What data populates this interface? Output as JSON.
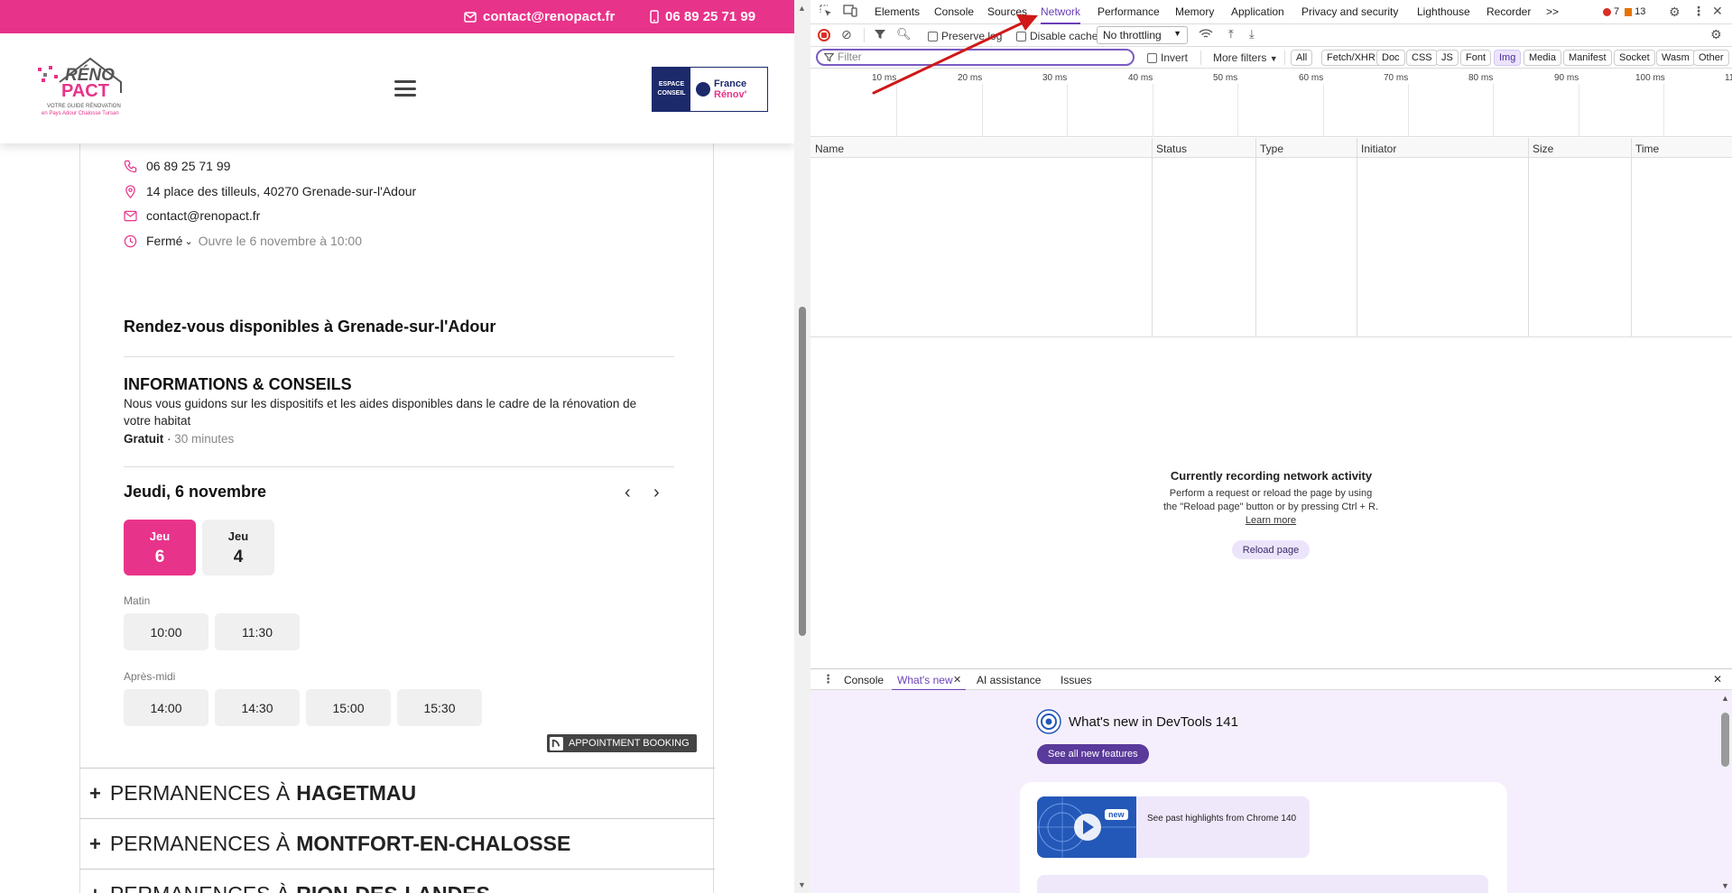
{
  "site": {
    "topbar": {
      "email": "contact@renopact.fr",
      "phone": "06 89 25 71 99"
    },
    "logo": {
      "brand_top": "RÉNO",
      "brand_bottom": "PACT",
      "tagline1": "VOTRE GUIDE RÉNOVATION",
      "tagline2": "en Pays Adour Chalosse Tursan"
    },
    "badge": {
      "left_line1": "ESPACE",
      "left_line2": "CONSEIL",
      "right_line1": "France",
      "right_line2": "Rénov'"
    },
    "contact": {
      "phone": "06 89 25 71 99",
      "address": "14 place des tilleuls, 40270 Grenade-sur-l'Adour",
      "email": "contact@renopact.fr",
      "status": "Fermé",
      "opens": "Ouvre le 6 novembre à 10:00"
    },
    "rdv_title": "Rendez-vous disponibles à Grenade-sur-l'Adour",
    "service": {
      "title": "INFORMATIONS & CONSEILS",
      "description": "Nous vous guidons sur les dispositifs et les aides disponibles dans le cadre de la rénovation de votre habitat",
      "price": "Gratuit",
      "separator": " · ",
      "duration": "30 minutes"
    },
    "date_heading": "Jeudi, 6 novembre",
    "days": [
      {
        "name": "Jeu",
        "num": "6"
      },
      {
        "name": "Jeu",
        "num": "4"
      }
    ],
    "morning_label": "Matin",
    "morning_slots": [
      "10:00",
      "11:30"
    ],
    "afternoon_label": "Après-midi",
    "afternoon_slots": [
      "14:00",
      "14:30",
      "15:00",
      "15:30"
    ],
    "booking_tag": "APPOINTMENT BOOKING",
    "permanences": [
      {
        "prefix": "PERMANENCES À",
        "city": "HAGETMAU"
      },
      {
        "prefix": "PERMANENCES À",
        "city": "MONTFORT-EN-CHALOSSE"
      },
      {
        "prefix": "PERMANENCES À",
        "city": "RION-DES-LANDES"
      }
    ]
  },
  "devtools": {
    "tabs": [
      "Elements",
      "Console",
      "Sources",
      "Network",
      "Performance",
      "Memory",
      "Application",
      "Privacy and security",
      "Lighthouse",
      "Recorder"
    ],
    "more_tabs": ">>",
    "errors": "7",
    "warnings": "13",
    "toolbar": {
      "preserve_log": "Preserve log",
      "disable_cache": "Disable cache",
      "throttling": "No throttling"
    },
    "filter_placeholder": "Filter",
    "invert": "Invert",
    "more_filters": "More filters",
    "filter_pills": [
      "All",
      "Fetch/XHR",
      "Doc",
      "CSS",
      "JS",
      "Font",
      "Img",
      "Media",
      "Manifest",
      "Socket",
      "Wasm",
      "Other"
    ],
    "timeline_ticks": [
      "10 ms",
      "20 ms",
      "30 ms",
      "40 ms",
      "50 ms",
      "60 ms",
      "70 ms",
      "80 ms",
      "90 ms",
      "100 ms",
      "11"
    ],
    "columns": [
      "Name",
      "Status",
      "Type",
      "Initiator",
      "Size",
      "Time"
    ],
    "recording": {
      "title": "Currently recording network activity",
      "text": "Perform a request or reload the page by using the \"Reload page\" button or by pressing Ctrl + R.",
      "link": "Learn more",
      "button": "Reload page"
    },
    "drawer_tabs": [
      "Console",
      "What's new",
      "AI assistance",
      "Issues"
    ],
    "whats_new": {
      "title": "What's new in DevTools 141",
      "button": "See all new features",
      "badge": "new",
      "caption": "See past highlights from Chrome 140"
    },
    "colors": {
      "accent": "#6b3fb8",
      "site_pink": "#e8338a",
      "recording_red": "#d93025"
    }
  }
}
